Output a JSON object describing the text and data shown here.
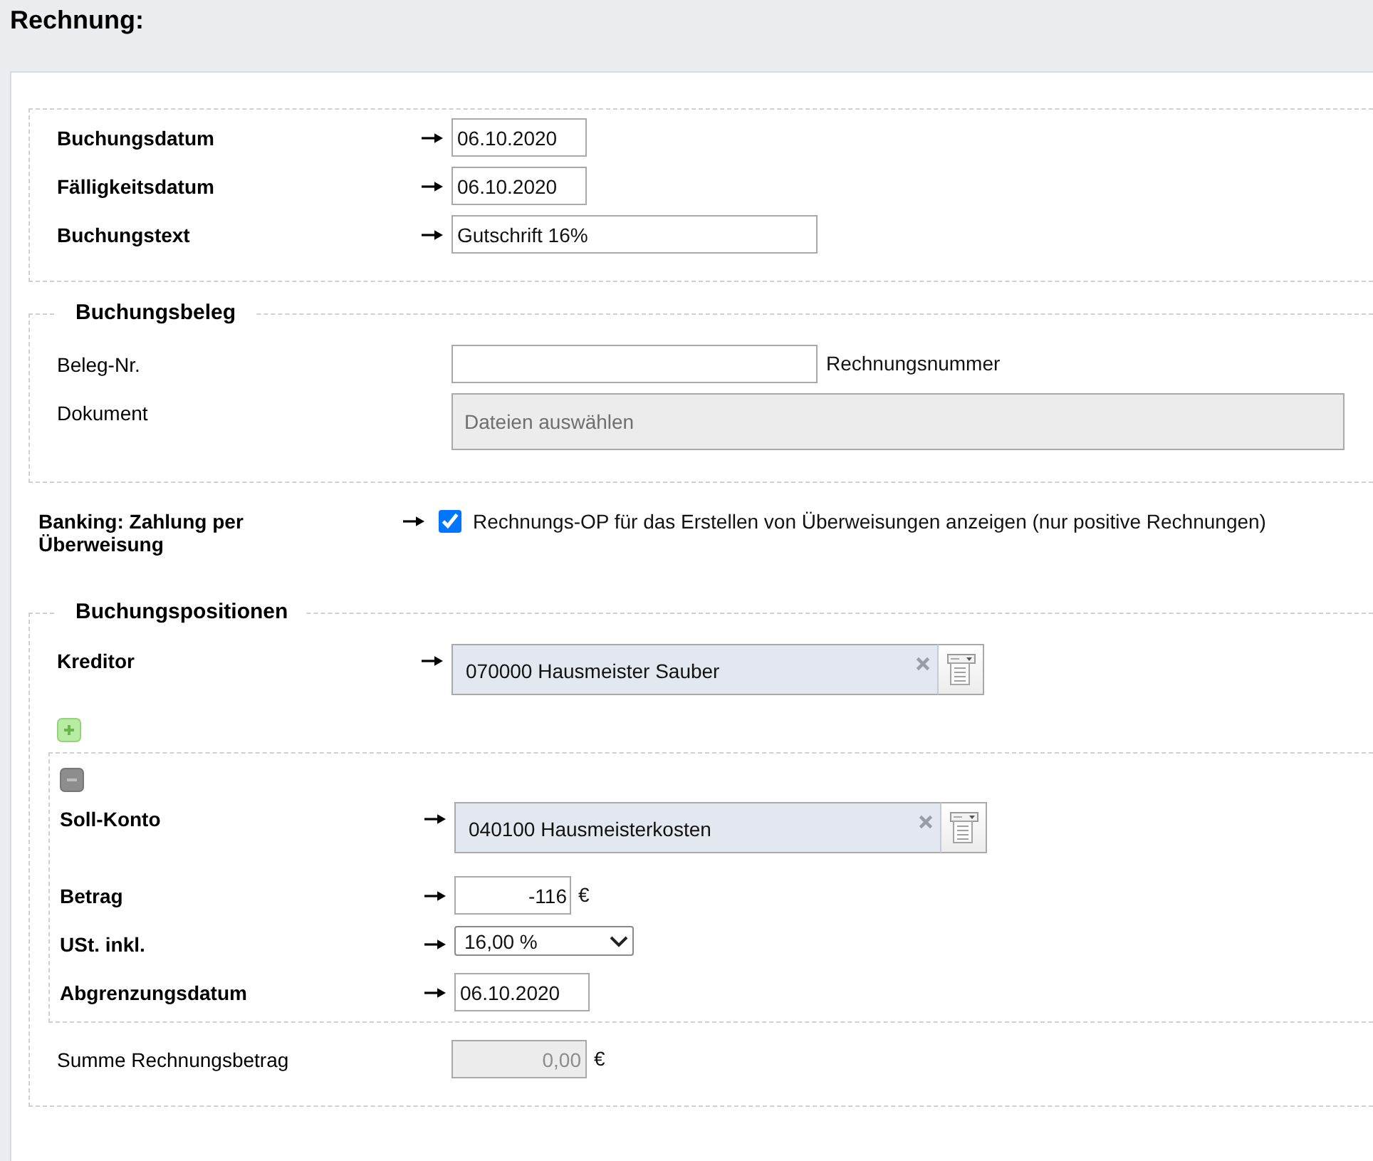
{
  "page": {
    "title": "Rechnung:"
  },
  "booking": {
    "fields": [
      {
        "kind": "date",
        "label": "Buchungsdatum",
        "required": true,
        "value": "06.10.2020"
      },
      {
        "kind": "date",
        "label": "Fälligkeitsdatum",
        "required": true,
        "value": "06.10.2020"
      },
      {
        "kind": "text",
        "label": "Buchungstext",
        "required": true,
        "value": "Gutschrift 16%"
      }
    ]
  },
  "receipt": {
    "legend": "Buchungsbeleg",
    "fields": [
      {
        "kind": "text",
        "label": "Beleg-Nr.",
        "required": false,
        "suffix": "Rechnungsnummer"
      },
      {
        "kind": "file",
        "label": "Dokument",
        "required": false,
        "placeholder": "Dateien auswählen"
      }
    ]
  },
  "banking": {
    "label": "Banking: Zahlung per Überweisung",
    "required": true,
    "checkbox": {
      "checked": true,
      "label": "Rechnungs-OP für das Erstellen von Überweisungen anzeigen (nur positive Rechnungen)"
    }
  },
  "positions": {
    "legend": "Buchungspositionen",
    "creditor": {
      "label": "Kreditor",
      "required": true,
      "value": "070000 Hausmeister Sauber"
    },
    "lines": [
      {
        "fields": [
          {
            "kind": "account",
            "label": "Soll-Konto",
            "required": true,
            "value": "040100 Hausmeisterkosten"
          },
          {
            "kind": "amount",
            "label": "Betrag",
            "required": true,
            "value": "-116",
            "unit": "€"
          },
          {
            "kind": "select",
            "label": "USt. inkl.",
            "required": true,
            "value": "16,00 %"
          },
          {
            "kind": "date",
            "label": "Abgrenzungsdatum",
            "required": true,
            "value": "06.10.2020"
          }
        ]
      }
    ],
    "total": {
      "label": "Summe Rechnungsbetrag",
      "required": false,
      "disabled": true,
      "value": "0,00",
      "unit": "€"
    }
  }
}
